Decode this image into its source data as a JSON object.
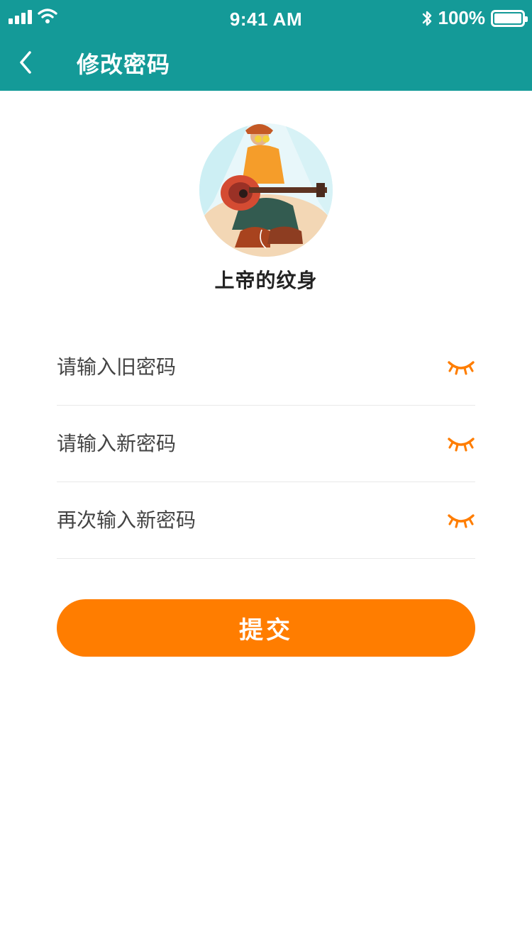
{
  "status_bar": {
    "time": "9:41 AM",
    "battery_percent": "100%"
  },
  "header": {
    "title": "修改密码"
  },
  "profile": {
    "username": "上帝的纹身"
  },
  "form": {
    "fields": [
      {
        "placeholder": "请输入旧密码"
      },
      {
        "placeholder": "请输入新密码"
      },
      {
        "placeholder": "再次输入新密码"
      }
    ],
    "submit_label": "提交"
  },
  "colors": {
    "header_bg": "#149A98",
    "accent": "#FF7D00",
    "divider": "#E9E9E9"
  },
  "icons": {
    "back": "chevron-left-icon",
    "password_toggle": "closed-eye-icon",
    "signal": "signal-icon",
    "wifi": "wifi-icon",
    "bluetooth": "bluetooth-icon",
    "battery": "battery-icon"
  }
}
